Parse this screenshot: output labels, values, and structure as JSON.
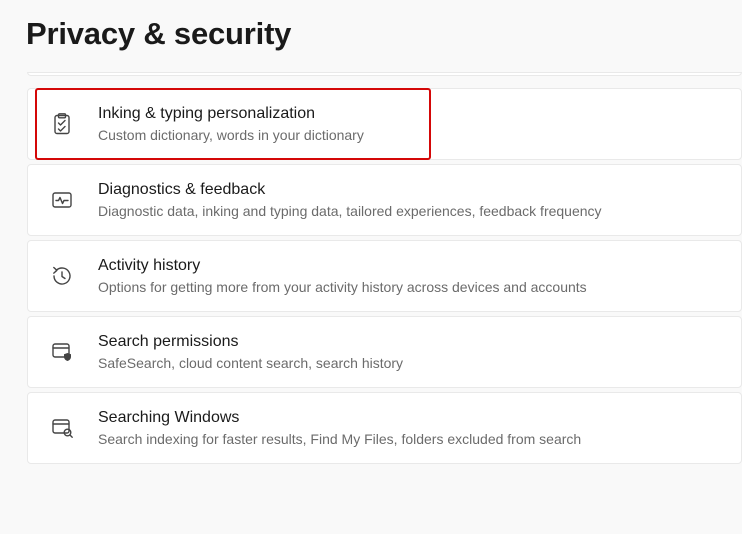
{
  "page": {
    "title": "Privacy & security"
  },
  "items": [
    {
      "icon": "clipboard-check-icon",
      "title": "Inking & typing personalization",
      "subtitle": "Custom dictionary, words in your dictionary",
      "highlighted": true
    },
    {
      "icon": "activity-icon",
      "title": "Diagnostics & feedback",
      "subtitle": "Diagnostic data, inking and typing data, tailored experiences, feedback frequency",
      "highlighted": false
    },
    {
      "icon": "history-icon",
      "title": "Activity history",
      "subtitle": "Options for getting more from your activity history across devices and accounts",
      "highlighted": false
    },
    {
      "icon": "window-shield-icon",
      "title": "Search permissions",
      "subtitle": "SafeSearch, cloud content search, search history",
      "highlighted": false
    },
    {
      "icon": "window-search-icon",
      "title": "Searching Windows",
      "subtitle": "Search indexing for faster results, Find My Files, folders excluded from search",
      "highlighted": false
    }
  ]
}
